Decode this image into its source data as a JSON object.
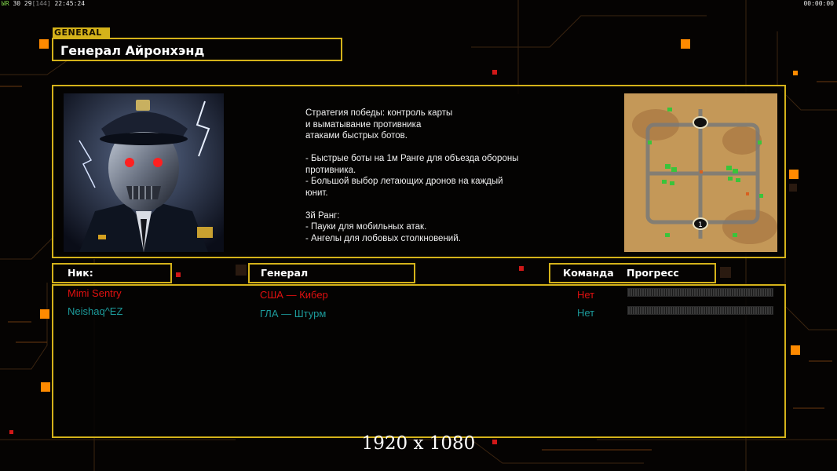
{
  "hud": {
    "left_green": "ЫR",
    "left_main": "30 29",
    "left_bracket": "[144]",
    "left_time": "22:45:24",
    "right_time": "00:00:00"
  },
  "general_tag": "GENERAL",
  "title": "Генерал Айронхэнд",
  "strategy_text": "Стратегия победы: контроль карты\nи выматывание противника\nатаками быстрых ботов.\n\n- Быстрые боты на 1м Ранге для объезда обороны\n  противника.\n- Большой выбор летающих дронов на каждый\n  юнит.\n\n3й Ранг:\n- Пауки для мобильных атак.\n- Ангелы для лобовых столкновений.",
  "columns": {
    "nick": "Ник:",
    "general": "Генерал",
    "team": "Команда",
    "progress": "Прогресс"
  },
  "players": [
    {
      "nick": "Mimi Sentry",
      "general": "США — Кибер",
      "team": "Нет",
      "color": "#e01010"
    },
    {
      "nick": "Neishaq^EZ",
      "general": "ГЛА — Штурм",
      "team": "Нет",
      "color": "#1c9a9a"
    }
  ],
  "resolution": "1920 x 1080",
  "colors": {
    "frame": "#d4b21a",
    "accent_orange": "#ff8a00",
    "red_square": "#d01818"
  }
}
